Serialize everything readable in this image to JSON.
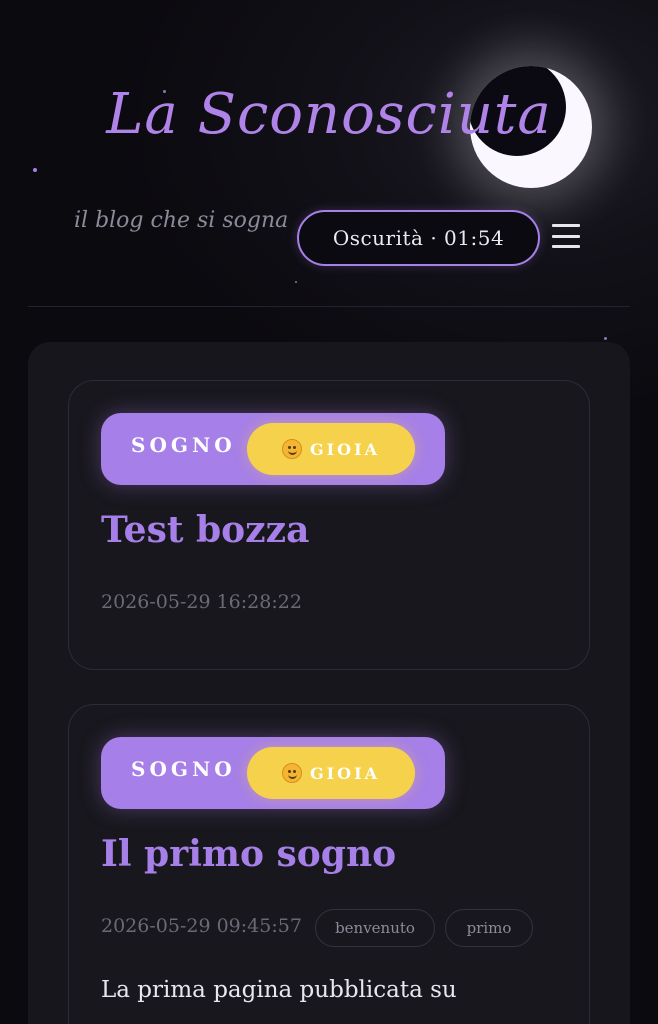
{
  "header": {
    "title": "La Sconosciuta",
    "tagline": "il blog che si sogna",
    "theme_toggle": "Oscurità · 01:54",
    "menu_icon": "hamburger-menu-icon",
    "moon_icon": "crescent-moon-icon"
  },
  "colors": {
    "accent": "#a67fe8",
    "mood_badge": "#f6d24c",
    "background": "#0b0a0f",
    "card": "#18171d"
  },
  "posts": [
    {
      "category": "SOGNO",
      "mood": "GIOIA",
      "mood_icon": "smiling-face-icon",
      "title": "Test bozza",
      "date": "2026-05-29 16:28:22",
      "tags": []
    },
    {
      "category": "SOGNO",
      "mood": "GIOIA",
      "mood_icon": "smiling-face-icon",
      "title": "Il primo sogno",
      "date": "2026-05-29 09:45:57",
      "tags": [
        "benvenuto",
        "primo"
      ],
      "excerpt": "La prima pagina pubblicata su"
    }
  ]
}
